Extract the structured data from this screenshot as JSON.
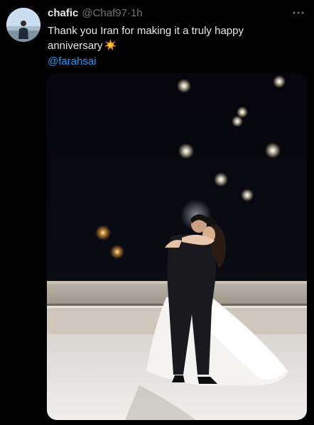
{
  "tweet": {
    "display_name": "chafic",
    "handle": "@Chaf97",
    "separator": "·",
    "time": "1h",
    "text": "Thank you Iran for making it a truly happy anniversary",
    "emoji": "collision-emoji",
    "mention": "@farahsai"
  },
  "icons": {
    "more": "more-horizontal-icon"
  },
  "colors": {
    "background": "#000000",
    "primary_text": "#e7e9ea",
    "secondary_text": "#71767b",
    "link": "#1d9bf0"
  },
  "media": {
    "kind": "photo",
    "subject": "wedding couple embracing under night sky with drone lights"
  }
}
